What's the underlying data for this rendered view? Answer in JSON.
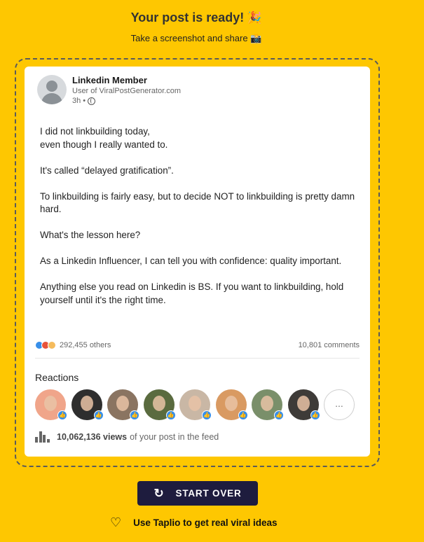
{
  "header": {
    "title": "Your post is ready!",
    "title_emoji": "🎉",
    "subtitle": "Take a screenshot and share 📸"
  },
  "post": {
    "author": "Linkedin Member",
    "author_subtitle": "User of ViralPostGenerator.com",
    "time": "3h •",
    "paragraphs": [
      "I did not linkbuilding today,\neven though I really wanted to.",
      "It's called “delayed gratification”.",
      "To linkbuilding is fairly easy, but to decide NOT to linkbuilding is pretty damn hard.",
      "What's the lesson here?",
      "As a Linkedin Influencer, I can tell you with confidence: quality important.",
      "Anything else you read on Linkedin is BS. If you want to linkbuilding, hold yourself until it's the right time."
    ],
    "reactions_count": "292,455 others",
    "comments_count": "10,801 comments",
    "reactions_title": "Reactions",
    "more_label": "...",
    "views_number": "10,062,136 views",
    "views_suffix": "of your post in the feed"
  },
  "reactor_colors": [
    "#f0a58a",
    "#2e2e2e",
    "#8a7461",
    "#5a6b3f",
    "#c9b7a5",
    "#d99a62",
    "#7a8f6a",
    "#3e3b38"
  ],
  "actions": {
    "start_over": "START OVER",
    "taplio": "Use Taplio to get real viral ideas"
  },
  "colors": {
    "background": "#fec701",
    "button": "#1e1c3e",
    "like": "#378fe9"
  }
}
